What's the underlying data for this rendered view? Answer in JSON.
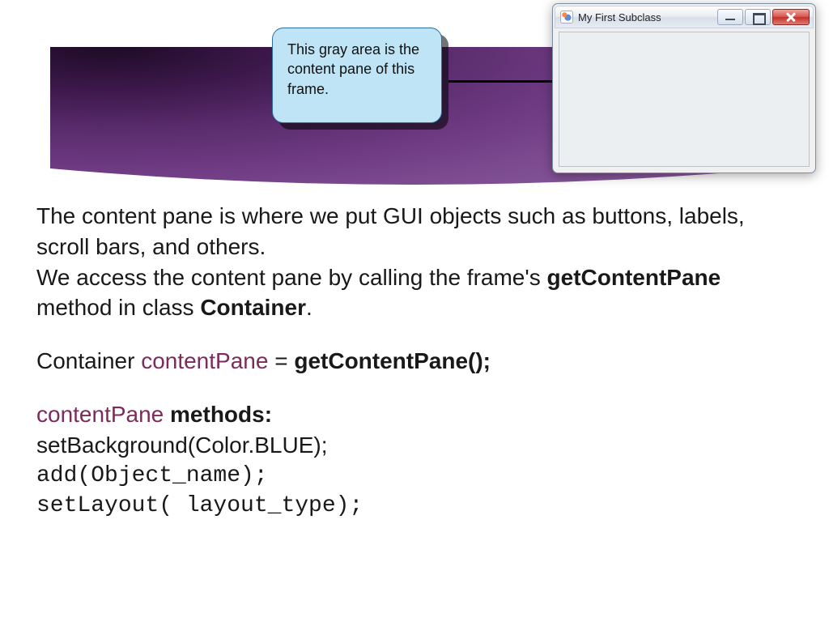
{
  "callout_text": "This gray area is the content pane of this frame.",
  "java_window": {
    "title": "My First Subclass"
  },
  "body": {
    "p1a": "The content pane is where we put GUI objects such as buttons, labels, scroll bars, and others.",
    "p1b_pre": "We access the content pane by calling the frame's ",
    "p1b_b1": "getContentPane",
    "p1b_mid": " method in class ",
    "p1b_b2": "Container",
    "p1b_post": ".",
    "decl_type": "Container ",
    "decl_var": "contentPane",
    "decl_eq": " = ",
    "decl_call": "getContentPane();",
    "methods_var": "contentPane",
    "methods_label": " methods:",
    "m1": "setBackground(Color.BLUE);",
    "m2": "add(Object_name);",
    "m3": "setLayout( layout_type);"
  }
}
